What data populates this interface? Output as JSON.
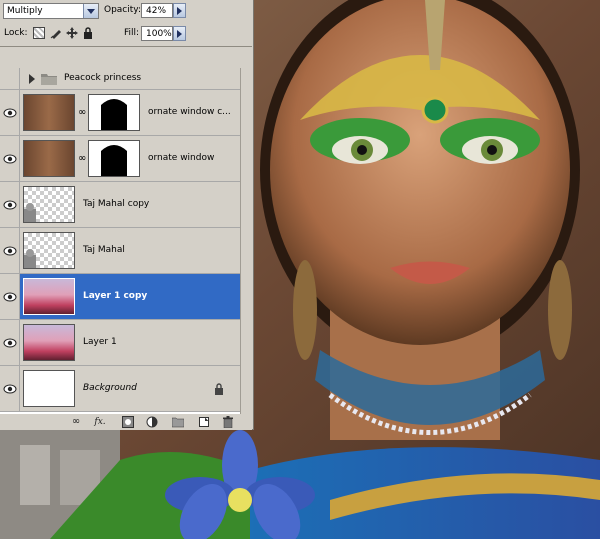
{
  "panel": {
    "blend_mode": "Multiply",
    "opacity_label": "Opacity:",
    "opacity_value": "42%",
    "lock_label": "Lock:",
    "fill_label": "Fill:",
    "fill_value": "100%"
  },
  "layers": [
    {
      "name": "Peacock princess",
      "type": "group"
    },
    {
      "name": "ornate window c...",
      "type": "masked"
    },
    {
      "name": "ornate window",
      "type": "masked"
    },
    {
      "name": "Taj Mahal copy",
      "type": "image"
    },
    {
      "name": "Taj Mahal",
      "type": "image"
    },
    {
      "name": "Layer 1 copy",
      "type": "image",
      "selected": true
    },
    {
      "name": "Layer 1",
      "type": "image"
    },
    {
      "name": "Background",
      "type": "background",
      "locked": true
    }
  ],
  "toolbar_icons": [
    "link-layers-icon",
    "fx-icon",
    "add-mask-icon",
    "adjustment-layer-icon",
    "new-group-icon",
    "new-layer-icon",
    "trash-icon"
  ],
  "toolbar_fx_label": "fx."
}
